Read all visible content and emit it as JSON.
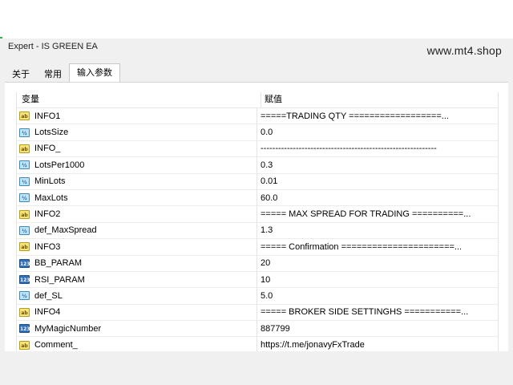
{
  "window": {
    "title": "Expert - IS GREEN EA"
  },
  "watermark": "www.mt4.shop",
  "tabs": [
    {
      "label": "关于"
    },
    {
      "label": "常用"
    },
    {
      "label": "输入参数"
    }
  ],
  "table": {
    "headers": {
      "variable": "变量",
      "value": "赋值"
    },
    "rows": [
      {
        "icon": "ab",
        "name": "INFO1",
        "value": "=====TRADING QTY ==================..."
      },
      {
        "icon": "half",
        "name": "LotsSize",
        "value": "0.0"
      },
      {
        "icon": "ab",
        "name": "INFO_",
        "value": "------------------------------------------------------------"
      },
      {
        "icon": "half",
        "name": "LotsPer1000",
        "value": "0.3"
      },
      {
        "icon": "half",
        "name": "MinLots",
        "value": "0.01"
      },
      {
        "icon": "half",
        "name": "MaxLots",
        "value": "60.0"
      },
      {
        "icon": "ab",
        "name": "INFO2",
        "value": "===== MAX SPREAD FOR TRADING ==========..."
      },
      {
        "icon": "half",
        "name": "def_MaxSpread",
        "value": "1.3"
      },
      {
        "icon": "ab",
        "name": "INFO3",
        "value": "===== Confirmation ======================..."
      },
      {
        "icon": "num",
        "name": "BB_PARAM",
        "value": "20"
      },
      {
        "icon": "num",
        "name": "RSI_PARAM",
        "value": "10"
      },
      {
        "icon": "half",
        "name": "def_SL",
        "value": "5.0"
      },
      {
        "icon": "ab",
        "name": "INFO4",
        "value": "===== BROKER SIDE SETTINGHS ===========..."
      },
      {
        "icon": "num",
        "name": "MyMagicNumber",
        "value": "887799"
      },
      {
        "icon": "ab",
        "name": "Comment_",
        "value": "https://t.me/jonavyFxTrade"
      }
    ]
  },
  "colors": {
    "active_tab_bg": "#ffffff",
    "green_edge": "#2fb34a"
  }
}
